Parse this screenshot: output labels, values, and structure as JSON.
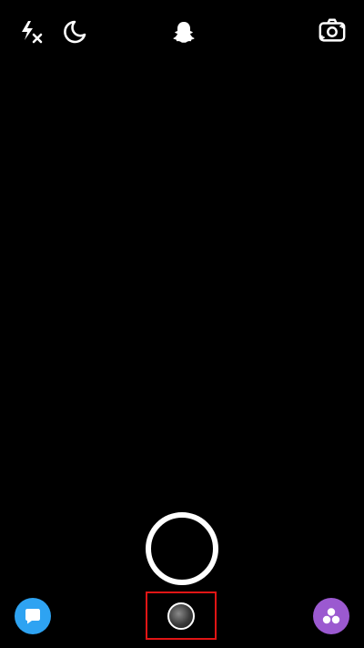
{
  "app": {
    "screen": "camera"
  },
  "top_bar": {
    "flash_icon": "flash-off-icon",
    "night_icon": "moon-icon",
    "center_icon": "snapchat-ghost-icon",
    "flip_icon": "flip-camera-icon"
  },
  "bottom_bar": {
    "chat_icon": "chat-bubble-icon",
    "memories_icon": "memories-thumbnail-icon",
    "discover_icon": "discover-icon"
  },
  "colors": {
    "background": "#000000",
    "icon": "#ffffff",
    "chat_button": "#2ea3f2",
    "discover_button": "#9b59d0",
    "highlight_box": "#e01515"
  }
}
